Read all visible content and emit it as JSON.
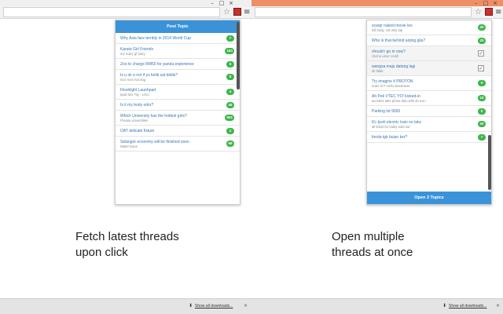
{
  "left": {
    "post_topic_label": "Post Topic",
    "threads": [
      {
        "title": "Why Asia fare terribly in 2014 World Cup",
        "subtitle": "",
        "count": "7"
      },
      {
        "title": "Karate Girl Friends",
        "subtitle": "my scary gf story",
        "count": "183"
      },
      {
        "title": "Zoo to charge RM50 for panda experience",
        "subtitle": "",
        "count": "5"
      },
      {
        "title": "Is u ok o not if yo kelik sat tiddis?",
        "subtitle": "nice nom hot dog",
        "count": "9"
      },
      {
        "title": "Fleshlight Launhpad",
        "subtitle": "Ipad Sex Toy - LOL!",
        "count": "4"
      },
      {
        "title": "Is it my body odor?",
        "subtitle": "",
        "count": "48"
      },
      {
        "title": "Which University has the hottest girls?",
        "subtitle": "Private universities",
        "count": "651"
      },
      {
        "title": "OAT delicate fixture",
        "subtitle": "",
        "count": "2"
      },
      {
        "title": "Selangor economy will be finished soon",
        "subtitle": "Water issue",
        "count": "68"
      }
    ],
    "caption_line1": "Fetch latest threads",
    "caption_line2": "upon click",
    "downloads_link": "Show all downloads..."
  },
  "right": {
    "threads": [
      {
        "title": "scarpr naked movie leo",
        "subtitle": "full body, not only top",
        "count": "20",
        "checked": false
      },
      {
        "title": "Who is that behind anjing gila?",
        "subtitle": "",
        "count": "20",
        "checked": false
      },
      {
        "title": "should i go in now?",
        "subtitle": "chat w umor crush",
        "count": "",
        "checked": true
      },
      {
        "title": "wangsa maju datang lagi",
        "subtitle": "sb falak",
        "count": "",
        "checked": true
      },
      {
        "title": "Try imagine if PROTON",
        "subtitle": "enter ICT niche bussiness",
        "count": "9",
        "checked": false
      },
      {
        "title": "Ah Pek VTEC YO! kicked-in",
        "subtitle": "accident take photo dulu with ah ma !",
        "count": "19",
        "checked": false
      },
      {
        "title": "Parking lot 9000",
        "subtitle": "",
        "count": "0",
        "checked": false
      },
      {
        "title": "KL-Ipoh electric train no lakz",
        "subtitle": "all ticket for today sold out",
        "count": "20",
        "checked": false
      },
      {
        "title": "fonda tgk buian ker?",
        "subtitle": "",
        "count": "7",
        "checked": false
      }
    ],
    "open_label": "Open 3 Topics",
    "caption_line1": "Open multiple",
    "caption_line2": "threads at once",
    "downloads_link": "Show all downloads..."
  },
  "colors": {
    "accent": "#3a93d8",
    "badge": "#3cb64a",
    "link": "#3575b5",
    "tab_strip_right": "#ee8f65"
  },
  "icons": [
    "star-icon",
    "extension-icon",
    "menu-icon",
    "download-icon",
    "close-icon",
    "checkmark-icon"
  ]
}
